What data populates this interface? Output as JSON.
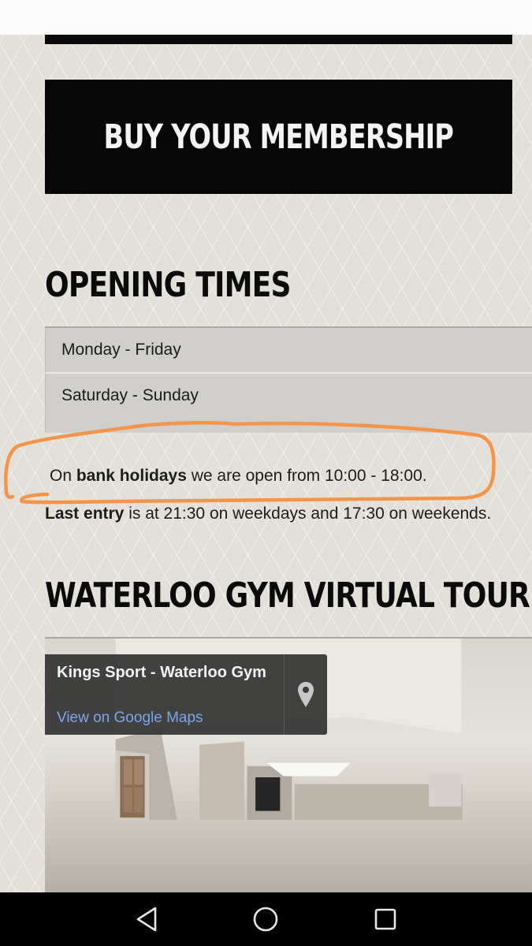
{
  "banner": {
    "label": "BUY YOUR MEMBERSHIP"
  },
  "opening_times": {
    "heading": "OPENING TIMES",
    "rows": [
      {
        "days": "Monday - Friday"
      },
      {
        "days": "Saturday - Sunday"
      }
    ],
    "bank_holiday": {
      "prefix": "On ",
      "bold": "bank holidays",
      "suffix": " we are open from 10:00 - 18:00."
    },
    "last_entry": {
      "bold": "Last entry",
      "suffix": " is at 21:30 on weekdays and 17:30 on weekends."
    }
  },
  "virtual_tour": {
    "heading": "WATERLOO GYM VIRTUAL TOUR",
    "card_title": "Kings Sport - Waterloo Gym",
    "card_link": "View on Google Maps"
  },
  "nav": {
    "back_icon": "back-triangle-icon",
    "home_icon": "home-circle-icon",
    "recents_icon": "recents-square-icon"
  },
  "colors": {
    "annotation": "#f2954a",
    "link": "#79a6e8",
    "banner_bg": "#070707"
  }
}
